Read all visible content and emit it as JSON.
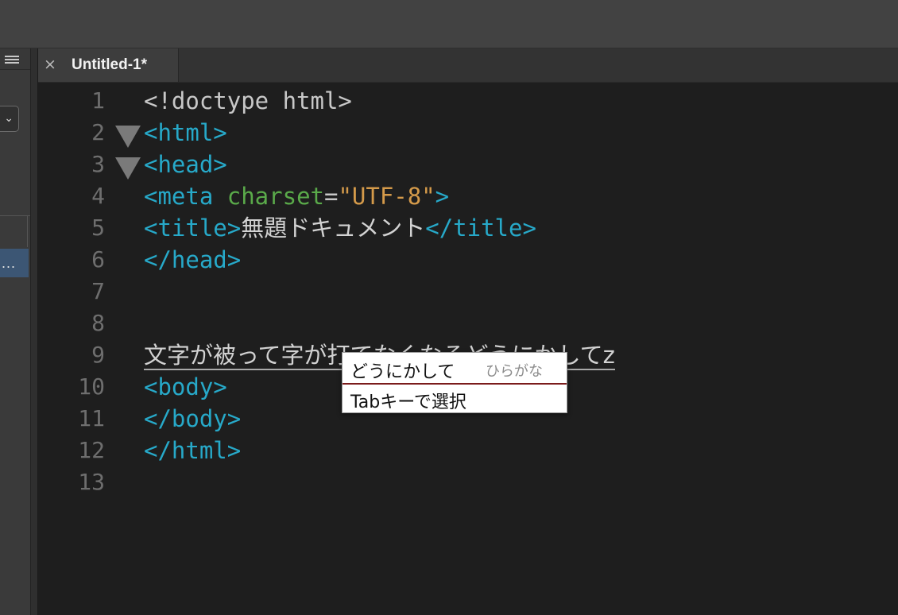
{
  "tab": {
    "close_glyph": "×",
    "title": "Untitled-1*"
  },
  "left_panel": {
    "chevron": "⌄",
    "selected_item": "..."
  },
  "editor": {
    "line_numbers": [
      "1",
      "2",
      "3",
      "4",
      "5",
      "6",
      "7",
      "8",
      "9",
      "10",
      "11",
      "12",
      "13"
    ],
    "lines": {
      "l1": "<!doctype html>",
      "l2": "<html>",
      "l3": "<head>",
      "l4_tag_open": "<meta ",
      "l4_attr": "charset",
      "l4_eq": "=",
      "l4_str": "\"UTF-8\"",
      "l4_tag_close": ">",
      "l5_open": "<title>",
      "l5_text": "無題ドキュメント",
      "l5_close": "</title>",
      "l6": "</head>",
      "l9_text": "文字が被って字が打てなくなるどうにかしてz",
      "l10": "<body>",
      "l11": "</body>",
      "l12": "</html>"
    }
  },
  "ime": {
    "candidate": "どうにかして",
    "mode": "ひらがな",
    "hint": "Tabキーで選択"
  },
  "colors": {
    "tag": "#27a9c9",
    "attribute": "#5aaa4a",
    "string": "#d49a4a",
    "text": "#c8c8c8",
    "ime_underline": "#7b1c1c"
  }
}
